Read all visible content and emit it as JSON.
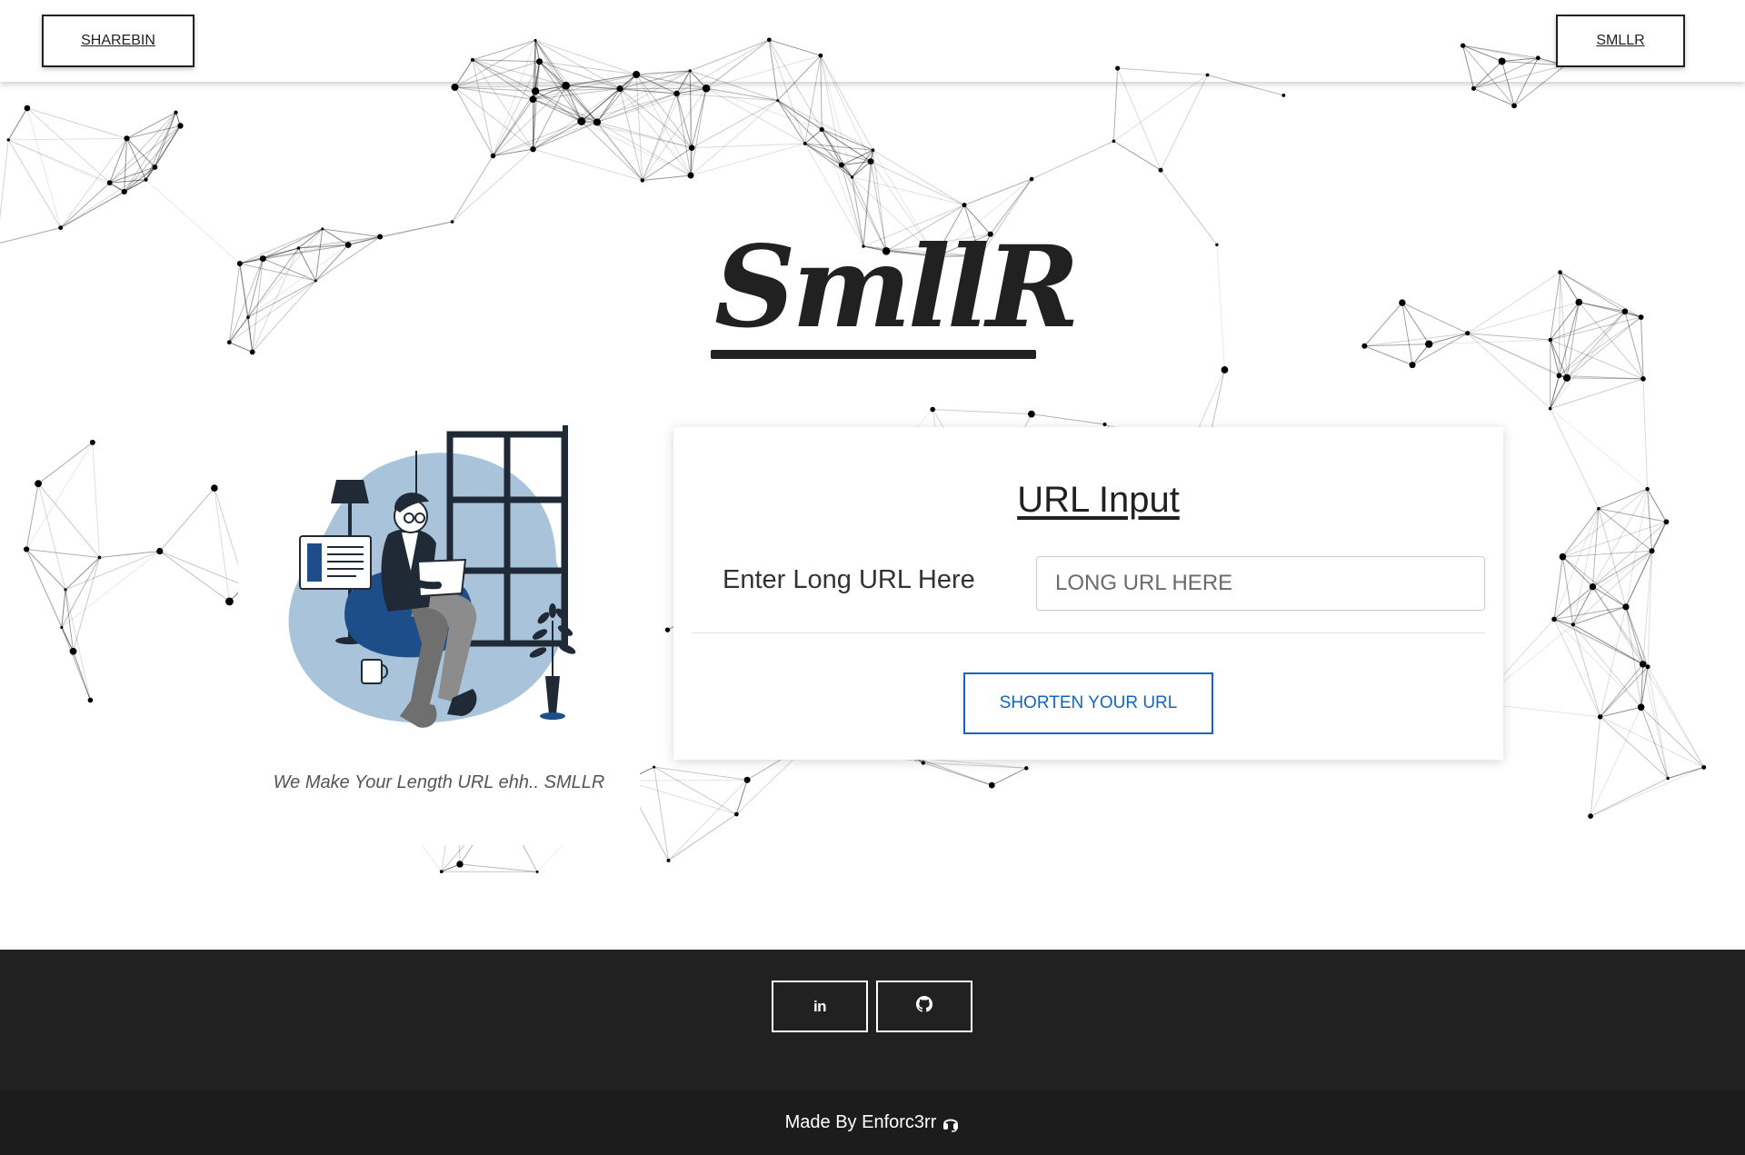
{
  "nav": {
    "left_label": "SHAREBIN",
    "right_label": "SMLLR"
  },
  "hero": {
    "logo_text": "SmllR",
    "tagline": "We Make Your Length URL ehh.. SMLLR"
  },
  "form": {
    "title": "URL Input",
    "field_label": "Enter Long URL Here",
    "input_placeholder": "LONG URL HERE",
    "input_value": "",
    "submit_label": "SHORTEN YOUR URL"
  },
  "footer": {
    "social": [
      {
        "icon": "linkedin-icon",
        "glyph": "in"
      },
      {
        "icon": "github-icon"
      }
    ],
    "credit": "Made By Enforc3rr",
    "credit_icon": "headset-icon"
  },
  "colors": {
    "accent": "#1565c0",
    "dark": "#212121",
    "footer_bg": "#212121",
    "illustration_primary": "#1d4e89",
    "illustration_light": "#a9c4da"
  }
}
